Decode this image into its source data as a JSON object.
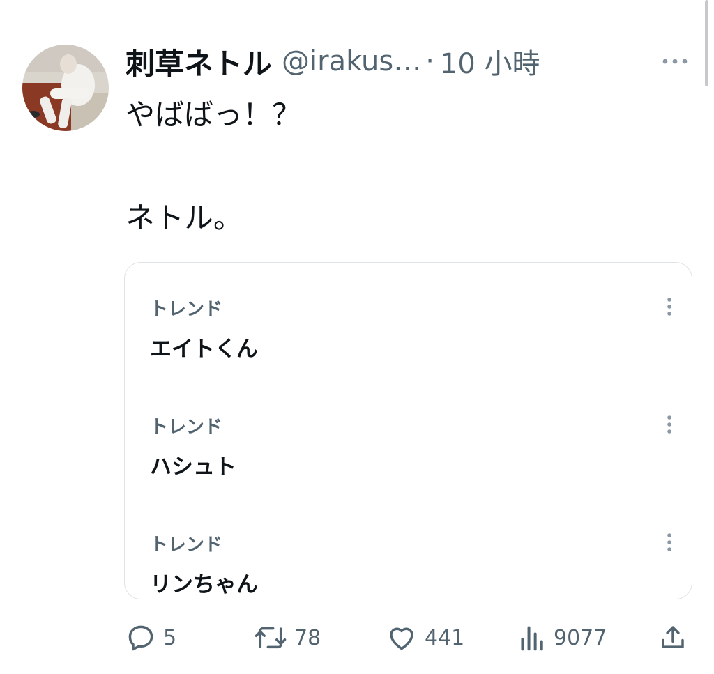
{
  "tweet": {
    "author": {
      "display_name": "刺草ネトル",
      "handle": "@irakus…"
    },
    "separator": "·",
    "time": "10 小時",
    "text_lines": [
      "やばばっ！？",
      "ネトル。"
    ]
  },
  "embedded_card": {
    "trends": [
      {
        "label": "トレンド",
        "name": "エイトくん"
      },
      {
        "label": "トレンド",
        "name": "ハシュト"
      },
      {
        "label": "トレンド",
        "name": "リンちゃん"
      }
    ]
  },
  "actions": {
    "replies": "5",
    "retweets": "78",
    "likes": "441",
    "views": "9077"
  },
  "icons": {
    "more": "more-horizontal-icon",
    "trend_more": "more-vertical-icon",
    "reply": "reply-icon",
    "retweet": "retweet-icon",
    "like": "heart-icon",
    "views": "views-icon",
    "share": "share-icon"
  },
  "colors": {
    "text": "#0f1419",
    "secondary": "#536471",
    "border": "#dfe3e6"
  }
}
